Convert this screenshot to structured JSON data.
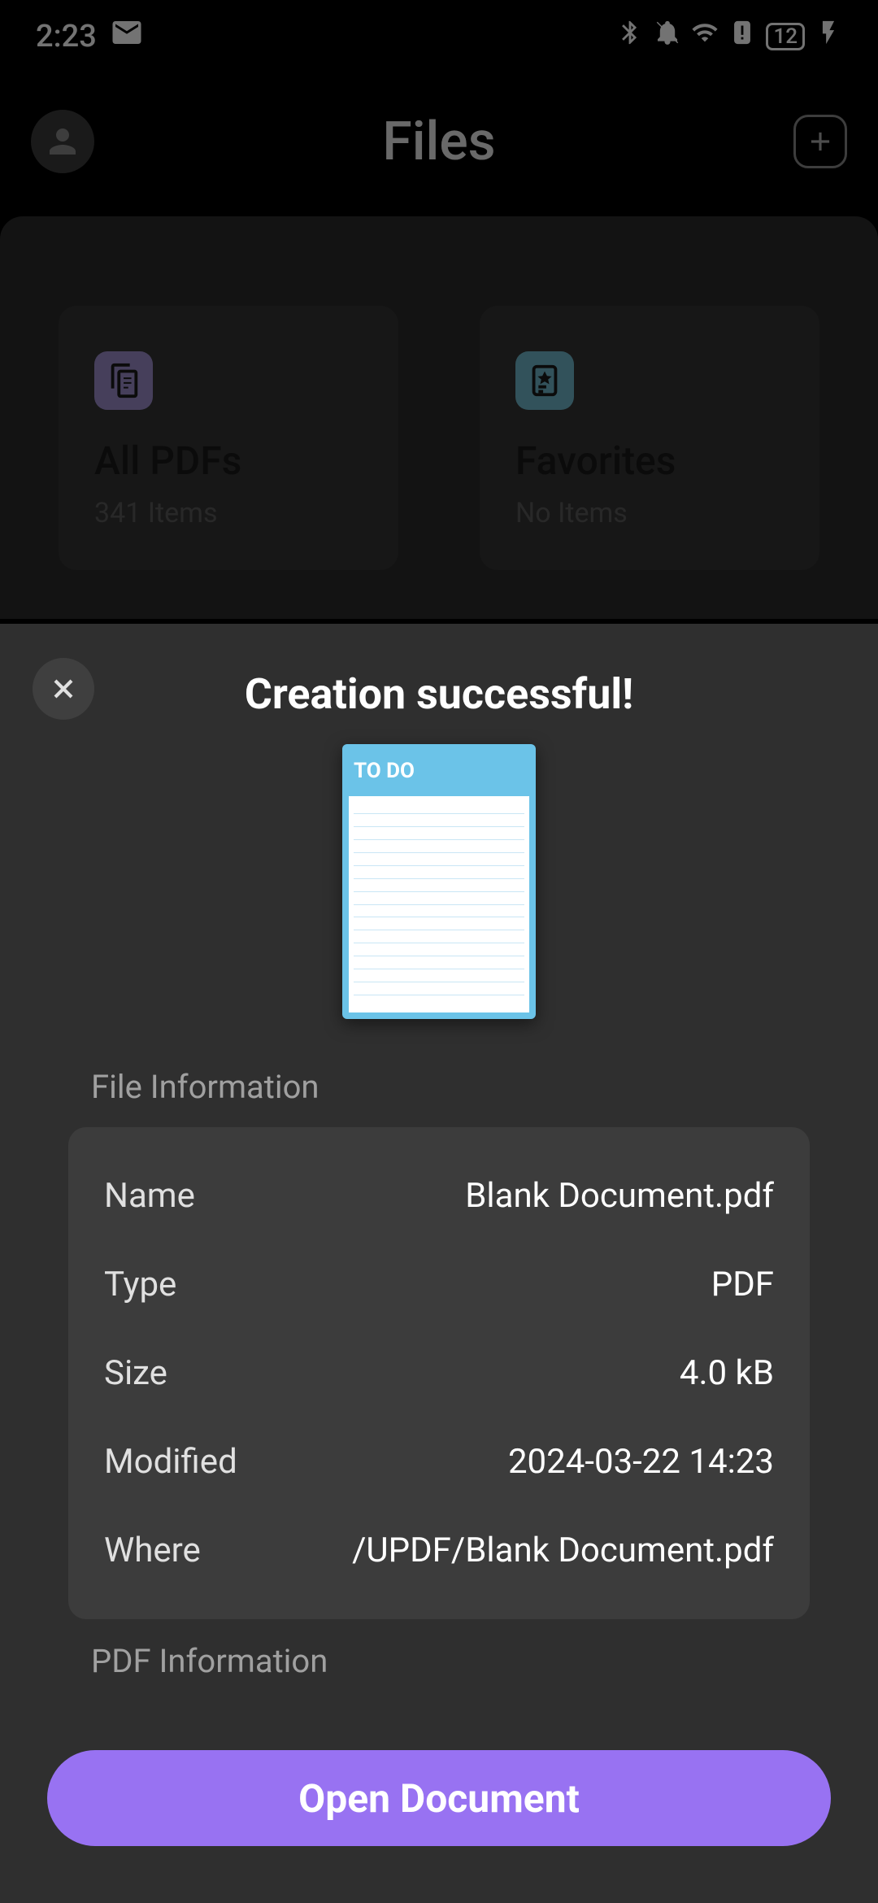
{
  "status": {
    "time": "2:23",
    "battery": "12"
  },
  "header": {
    "title": "Files"
  },
  "cards": {
    "all_pdfs": {
      "title": "All PDFs",
      "subtitle": "341 Items"
    },
    "favorites": {
      "title": "Favorites",
      "subtitle": "No Items"
    }
  },
  "sheet": {
    "title": "Creation successful!",
    "preview_header": "TO DO",
    "section_file_info": "File Information",
    "section_pdf_info": "PDF Information",
    "rows": {
      "name": {
        "label": "Name",
        "value": "Blank Document.pdf"
      },
      "type": {
        "label": "Type",
        "value": "PDF"
      },
      "size": {
        "label": "Size",
        "value": "4.0 kB"
      },
      "modified": {
        "label": "Modified",
        "value": "2024-03-22 14:23"
      },
      "where": {
        "label": "Where",
        "value": "/UPDF/Blank Document.pdf"
      }
    },
    "open_btn": "Open Document"
  }
}
